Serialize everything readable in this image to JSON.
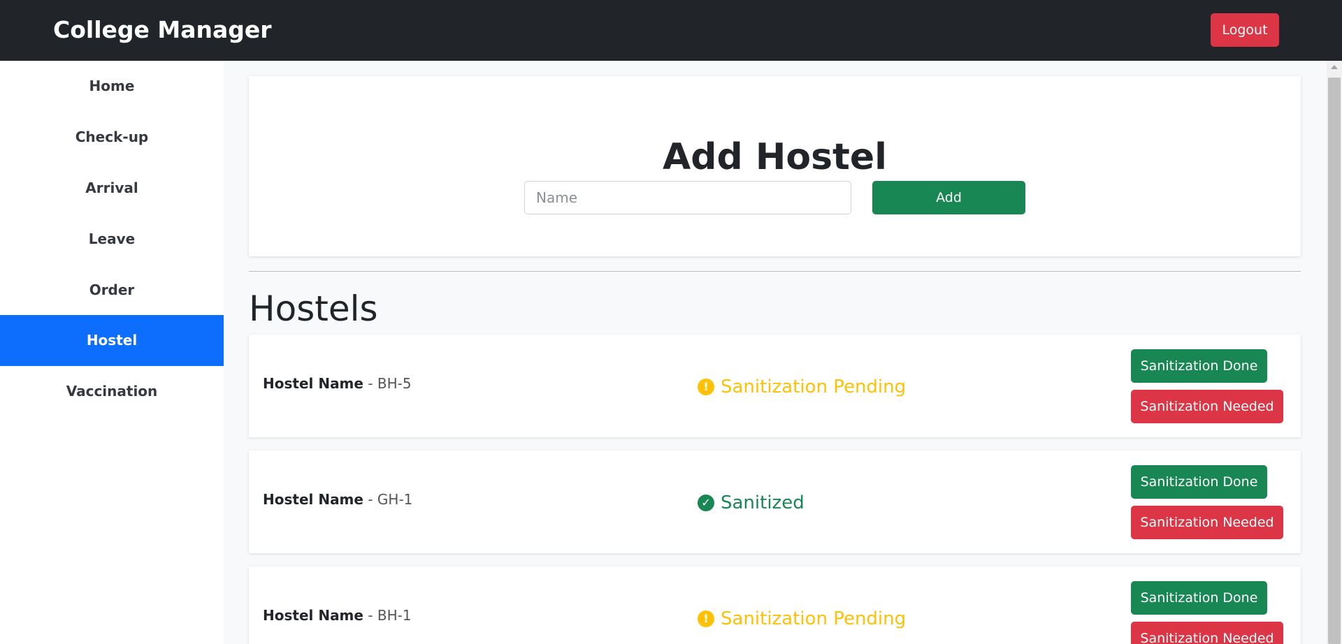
{
  "app": {
    "brand": "College Manager",
    "logout_label": "Logout"
  },
  "sidebar": {
    "items": [
      {
        "label": "Home"
      },
      {
        "label": "Check-up"
      },
      {
        "label": "Arrival"
      },
      {
        "label": "Leave"
      },
      {
        "label": "Order"
      },
      {
        "label": "Hostel",
        "active": true
      },
      {
        "label": "Vaccination"
      }
    ]
  },
  "add_hostel": {
    "title": "Add Hostel",
    "name_placeholder": "Name",
    "name_value": "",
    "add_label": "Add"
  },
  "hostels": {
    "title": "Hostels",
    "name_label": "Hostel Name",
    "separator": "-",
    "done_label": "Sanitization Done",
    "needed_label": "Sanitization Needed",
    "items": [
      {
        "name": "BH-5",
        "status": "Sanitization Pending",
        "status_icon": "exclamation-circle-icon"
      },
      {
        "name": "GH-1",
        "status": "Sanitized",
        "status_icon": "check-circle-icon"
      },
      {
        "name": "BH-1",
        "status": "Sanitization Pending",
        "status_icon": "exclamation-circle-icon"
      }
    ]
  },
  "colors": {
    "navbar": "#212529",
    "active_nav": "#0d6efd",
    "success": "#198754",
    "danger": "#dc3545",
    "warning": "#ffc107"
  }
}
